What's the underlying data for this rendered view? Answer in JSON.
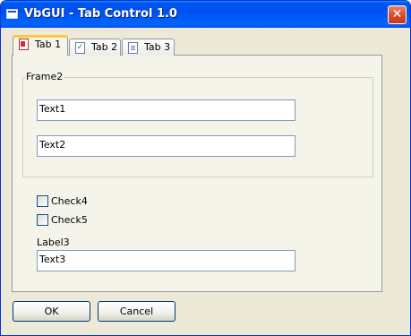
{
  "window": {
    "title": "VbGUI - Tab Control 1.0",
    "close_glyph": "✕",
    "app_icon": "window-app-icon"
  },
  "tabs": [
    {
      "label": "Tab 1",
      "icon": "document-icon",
      "active": true
    },
    {
      "label": "Tab 2",
      "icon": "checklist-icon",
      "active": false
    },
    {
      "label": "Tab 3",
      "icon": "page-icon",
      "active": false
    }
  ],
  "frame": {
    "legend": "Frame2",
    "text1": "Text1",
    "text2": "Text2"
  },
  "checks": [
    {
      "label": "Check4",
      "checked": false
    },
    {
      "label": "Check5",
      "checked": false
    }
  ],
  "label3": "Label3",
  "text3": "Text3",
  "buttons": {
    "ok": "OK",
    "cancel": "Cancel"
  },
  "colors": {
    "titlebar": "#0054e3",
    "dialog_bg": "#ece9d8",
    "panel_bg": "#f5f4ea",
    "active_tab_accent": "#ffc83c",
    "close_button": "#d9542f"
  }
}
